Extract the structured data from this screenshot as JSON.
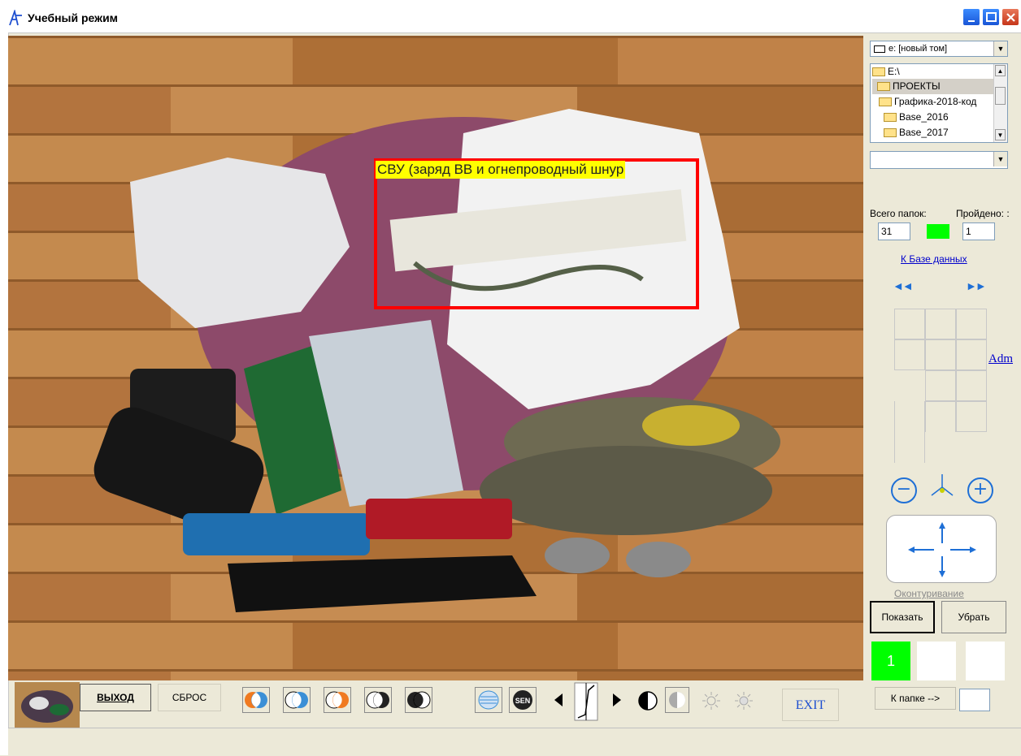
{
  "window": {
    "title": "Учебный режим"
  },
  "image": {
    "detection_label": "СВУ (заряд ВВ и огнепроводный шнур"
  },
  "panel": {
    "drive": "e: [новый том]",
    "tree": [
      {
        "label": "E:\\",
        "selected": false
      },
      {
        "label": "ПРОЕКТЫ",
        "selected": true
      },
      {
        "label": "Графика-2018-код",
        "selected": false
      },
      {
        "label": "Base_2016",
        "selected": false
      },
      {
        "label": "Base_2017",
        "selected": false
      }
    ],
    "combo_value": "",
    "total_folders_label": "Всего папок:",
    "total_folders_value": "31",
    "passed_label": "Пройдено: :",
    "passed_value": "1",
    "db_link": "К Базе данных",
    "prev_arrows": "◄◄",
    "next_arrows": "►►",
    "adm_link": "Adm",
    "zoom_out": "−",
    "zoom_in": "+",
    "contour_label": "Оконтуривание",
    "show_button": "Показать",
    "hide_button": "Убрать",
    "slot_1": "1",
    "to_folder_button": "К папке -->",
    "folder_input": ""
  },
  "toolbar": {
    "exit_ru": "ВЫХОД",
    "reset": "СБРОС",
    "exit_en": "EXIT",
    "sen_label": "SEN"
  },
  "colors": {
    "detect_box": "#ff0000",
    "label_bg": "#ffff00",
    "indicator": "#00ff00",
    "link": "#0000cc",
    "accent_blue": "#1e6fd6"
  }
}
